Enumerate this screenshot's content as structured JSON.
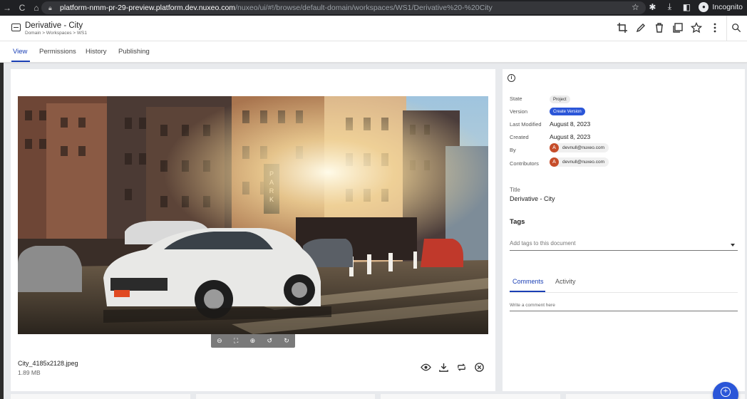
{
  "browser": {
    "url_host": "platform-nmm-pr-29-preview.platform.dev.nuxeo.com",
    "url_path": "/nuxeo/ui/#!/browse/default-domain/workspaces/WS1/Derivative%20-%20City",
    "profile_label": "Incognito"
  },
  "header": {
    "title": "Derivative - City",
    "breadcrumb": "Domain > Workspaces > WS1"
  },
  "tabs": [
    {
      "label": "View",
      "active": true
    },
    {
      "label": "Permissions",
      "active": false
    },
    {
      "label": "History",
      "active": false
    },
    {
      "label": "Publishing",
      "active": false
    }
  ],
  "file": {
    "name": "City_4185x2128.jpeg",
    "size": "1.89 MB"
  },
  "metadata": {
    "state_label": "State",
    "state_value": "Project",
    "version_label": "Version",
    "version_button": "Create Version",
    "last_modified_label": "Last Modified",
    "last_modified_value": "August 8, 2023",
    "created_label": "Created",
    "created_value": "August 8, 2023",
    "by_label": "By",
    "by_user": "devnull@nuxeo.com",
    "by_initial": "A",
    "contributors_label": "Contributors",
    "contributor_user": "devnull@nuxeo.com",
    "contributor_initial": "A",
    "title_label": "Title",
    "title_value": "Derivative - City"
  },
  "tags": {
    "heading": "Tags",
    "placeholder": "Add tags to this document"
  },
  "comments": {
    "tabs": [
      "Comments",
      "Activity"
    ],
    "placeholder": "Write a comment here"
  },
  "colors": {
    "accent": "#1a3fb5",
    "button_blue": "#2b56d8",
    "avatar": "#c64d2a"
  }
}
